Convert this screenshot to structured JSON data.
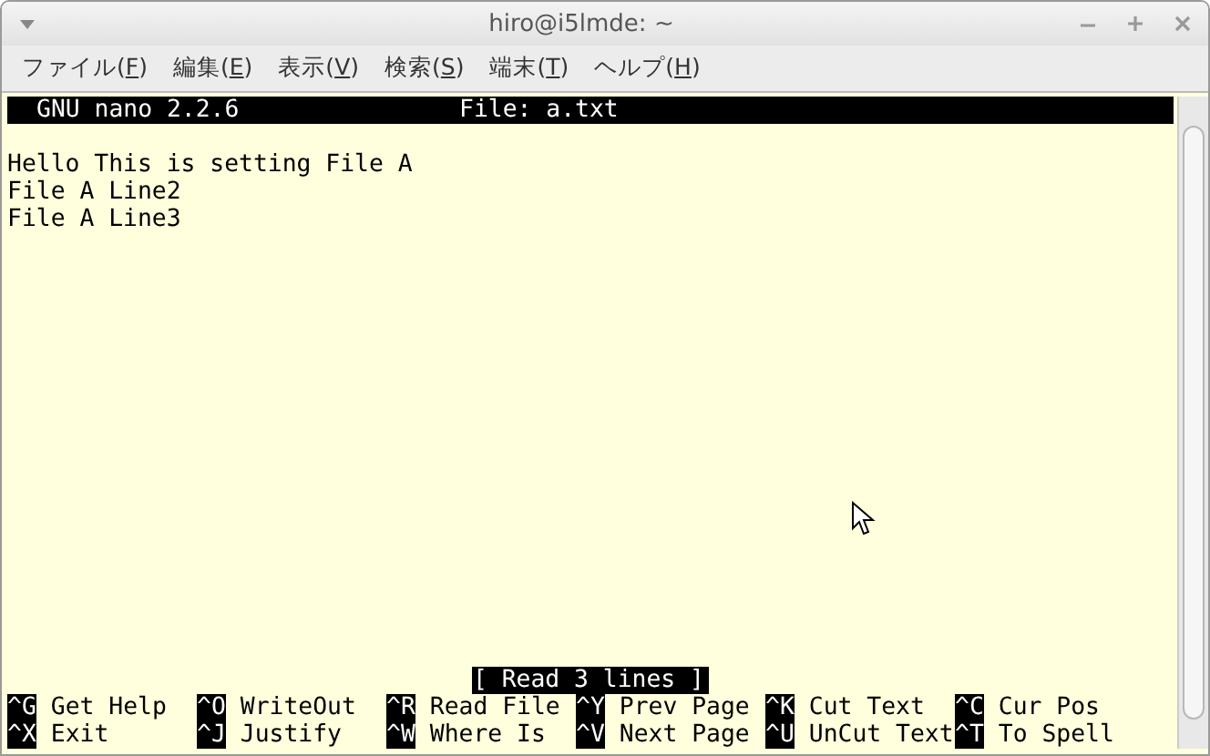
{
  "window": {
    "title": "hiro@i5lmde: ~"
  },
  "menu": [
    {
      "before": "ファイル(",
      "key": "F",
      "after": ")"
    },
    {
      "before": "編集(",
      "key": "E",
      "after": ")"
    },
    {
      "before": "表示(",
      "key": "V",
      "after": ")"
    },
    {
      "before": "検索(",
      "key": "S",
      "after": ")"
    },
    {
      "before": "端末(",
      "key": "T",
      "after": ")"
    },
    {
      "before": "ヘルプ(",
      "key": "H",
      "after": ")"
    }
  ],
  "nano": {
    "version": "GNU nano 2.2.6",
    "file": "File: a.txt",
    "lines": [
      "Hello This is setting File A",
      "File A Line2",
      "File A Line3"
    ],
    "status": "[ Read 3 lines ]",
    "shortcuts": [
      [
        {
          "key": "^G",
          "label": "Get Help"
        },
        {
          "key": "^O",
          "label": "WriteOut"
        },
        {
          "key": "^R",
          "label": "Read File"
        },
        {
          "key": "^Y",
          "label": "Prev Page"
        },
        {
          "key": "^K",
          "label": "Cut Text"
        },
        {
          "key": "^C",
          "label": "Cur Pos"
        }
      ],
      [
        {
          "key": "^X",
          "label": "Exit"
        },
        {
          "key": "^J",
          "label": "Justify"
        },
        {
          "key": "^W",
          "label": "Where Is"
        },
        {
          "key": "^V",
          "label": "Next Page"
        },
        {
          "key": "^U",
          "label": "UnCut Text"
        },
        {
          "key": "^T",
          "label": "To Spell"
        }
      ]
    ]
  }
}
